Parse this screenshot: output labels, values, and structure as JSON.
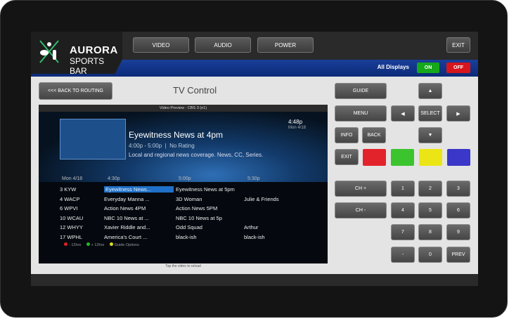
{
  "brand": {
    "line1": "AURORA",
    "line2": "SPORTS BAR"
  },
  "top_nav": [
    "VIDEO",
    "AUDIO",
    "POWER"
  ],
  "exit_label": "EXIT",
  "displays": {
    "label": "All Displays",
    "on": "ON",
    "off": "OFF"
  },
  "back_button": "<<< BACK TO ROUTING",
  "page_title": "TV Control",
  "preview": {
    "header": "Video Preview - CBS 3 (e1)",
    "show_title": "Eyewitness News at 4pm",
    "show_time": "4:00p - 5:00p",
    "rating": "No Rating",
    "description": "Local and regional news coverage. News, CC, Series.",
    "clock": "4:48p",
    "clock_date": "Mon 4/18",
    "timeline": [
      "Mon 4/18",
      "4:30p",
      "5:00p",
      "5:30p"
    ],
    "rows": [
      {
        "ch": "3 KYW",
        "p1": "Eyewitness News...",
        "p2": "Eyewitness News at 5pm",
        "p3": "",
        "hl": true
      },
      {
        "ch": "4 WACP",
        "p1": "Everyday Manna ...",
        "p2": "3D Woman",
        "p3": "Julie & Friends",
        "hl": false
      },
      {
        "ch": "6 WPVI",
        "p1": "Action News 4PM",
        "p2": "Action News 5PM",
        "p3": "",
        "hl": false
      },
      {
        "ch": "10 WCAU",
        "p1": "NBC 10 News at ...",
        "p2": "NBC 10 News at 5p",
        "p3": "",
        "hl": false
      },
      {
        "ch": "12 WHYY",
        "p1": "Xavier Riddle and...",
        "p2": "Odd Squad",
        "p3": "Arthur",
        "hl": false
      },
      {
        "ch": "17 WPHL",
        "p1": "America's Court ...",
        "p2": "black-ish",
        "p3": "black-ish",
        "hl": false
      }
    ],
    "legend": [
      "- 12hrs",
      "+ 12hrs",
      "Guide Options"
    ],
    "hint": "Tap the video to reload"
  },
  "remote": {
    "guide": "GUIDE",
    "menu": "MENU",
    "select": "SELECT",
    "info": "INFO",
    "back": "BACK",
    "exit": "EXIT",
    "ch_up": "CH +",
    "ch_down": "CH -",
    "prev": "PREV",
    "keys": [
      "1",
      "2",
      "3",
      "4",
      "5",
      "6",
      "7",
      "8",
      "9",
      "-",
      "0"
    ],
    "colors": [
      "#e3232b",
      "#3cc42e",
      "#ece515",
      "#3b37c8"
    ]
  }
}
